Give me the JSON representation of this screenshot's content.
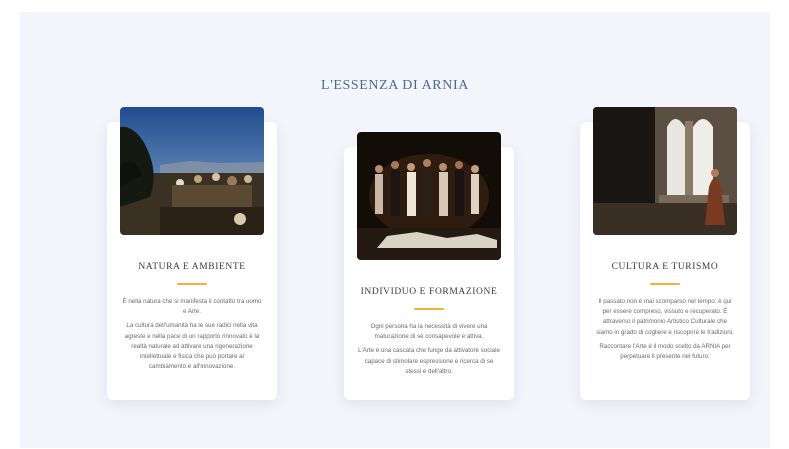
{
  "section": {
    "title": "L'ESSENZA DI ARNIA"
  },
  "cards": [
    {
      "title": "NATURA E AMBIENTE",
      "paragraphs": [
        "È nella natura che si manifesta il contatto tra uomo e Arte.",
        "La cultura dell'umanità ha le sue radici nella vita agreste e nella pace di un rapporto rinnovato è la realtà naturale ad attivare una rigenerazione intellettuale e fisica che può portare al cambiamento e all'innovazione."
      ]
    },
    {
      "title": "INDIVIDUO E FORMAZIONE",
      "paragraphs": [
        "Ogni persona ha la necessità di vivere una maturazione di sé consapevole e attiva.",
        "L'Arte è una cascata che funge da attivatore sociale capace di stimolare espressione e ricerca di se stessi e dell'altro."
      ]
    },
    {
      "title": "CULTURA E TURISMO",
      "paragraphs": [
        "Il passato non è mai scomparso nel tempo: è qui per essere compreso, vissuto e recuperato. È attraverso il patrimonio Artistico Culturale che siamo in grado di cogliere e riscoprire le tradizioni.",
        "Raccontare l'Arte è il modo scelto da ARNIA per perpetuare il presente nel futuro."
      ]
    }
  ],
  "colors": {
    "accent": "#f0b23a",
    "heading": "#4a6a92",
    "background": "#f4f5fb"
  }
}
